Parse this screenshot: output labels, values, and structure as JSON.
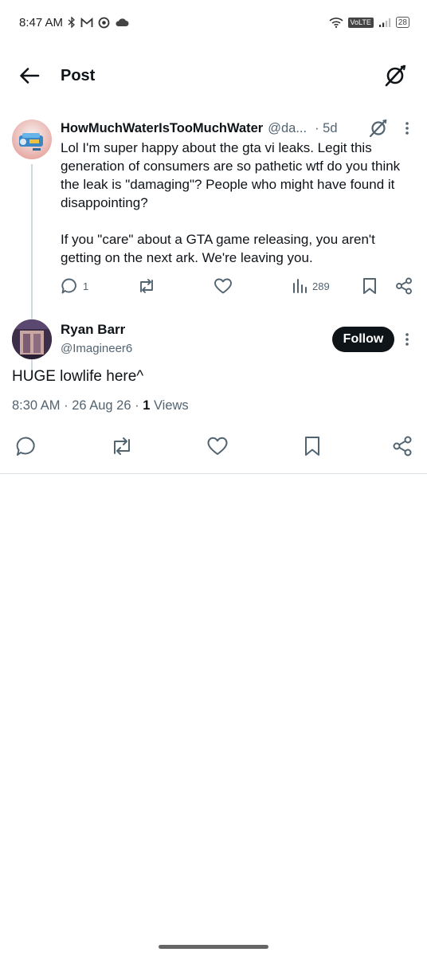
{
  "status_bar": {
    "time": "8:47 AM",
    "left_icons": [
      "bluetooth-icon",
      "gmail-icon",
      "vpn-icon",
      "cloud-icon"
    ],
    "volte": "VoLTE",
    "battery": "28"
  },
  "header": {
    "title": "Post"
  },
  "parent_post": {
    "display_name": "HowMuchWaterIsTooMuchWater",
    "handle": "@da...",
    "time": "· 5d",
    "text": "Lol I'm super happy about the gta vi leaks. Legit this generation of consumers are so pathetic wtf do you think the leak is \"damaging\"? People who might have found it disappointing?\n\nIf you \"care\" about a GTA game releasing, you aren't getting on the next ark. We're leaving you.",
    "reply_count": "1",
    "views_count": "289"
  },
  "reply_post": {
    "display_name": "Ryan Barr",
    "handle": "@Imagineer6",
    "follow_label": "Follow",
    "text": "HUGE lowlife here^",
    "timestamp": "8:30 AM · 26 Aug 26 · ",
    "views_count": "1",
    "views_label": " Views"
  },
  "colors": {
    "text_primary": "#0f1419",
    "text_secondary": "#536471",
    "follow_button_bg": "#0f1419",
    "thread_line": "#cfd9de"
  }
}
